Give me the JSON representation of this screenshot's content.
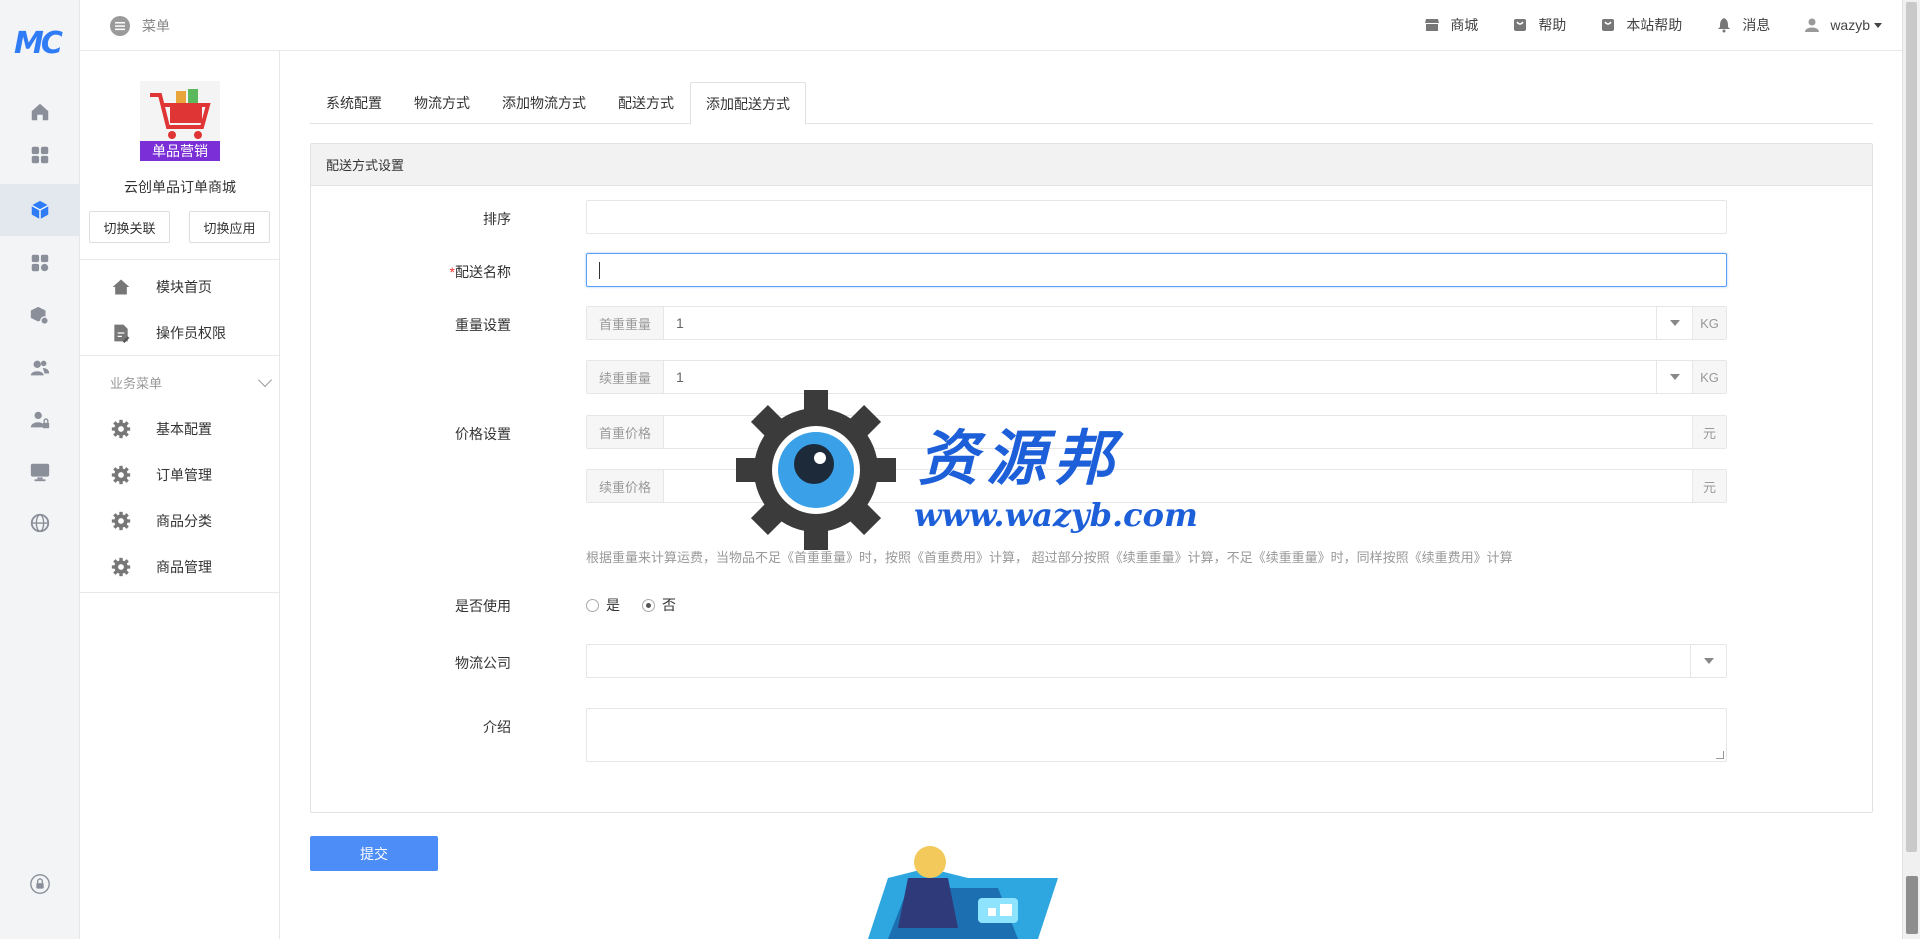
{
  "topbar": {
    "menu_label": "菜单",
    "items": [
      {
        "label": "商城",
        "icon": "store-icon"
      },
      {
        "label": "帮助",
        "icon": "help-bag-icon"
      },
      {
        "label": "本站帮助",
        "icon": "site-help-icon"
      },
      {
        "label": "消息",
        "icon": "bell-icon"
      }
    ],
    "user": "wazyb"
  },
  "rail": {
    "logo": "MC",
    "icons": [
      "home-icon",
      "grid-icon",
      "cube-icon",
      "apps-settings-icon",
      "package-settings-icon",
      "users-icon",
      "user-lock-icon",
      "monitor-icon",
      "globe-icon",
      "lock-icon"
    ]
  },
  "sidebar": {
    "app_logo_caption": "单品营销",
    "app_name": "云创单品订单商城",
    "switch_link": "切换关联",
    "switch_app": "切换应用",
    "top_items": [
      {
        "label": "模块首页",
        "icon": "home-icon"
      },
      {
        "label": "操作员权限",
        "icon": "doc-edit-icon"
      }
    ],
    "group_label": "业务菜单",
    "group_items": [
      {
        "label": "基本配置",
        "icon": "gear-icon"
      },
      {
        "label": "订单管理",
        "icon": "gear-icon"
      },
      {
        "label": "商品分类",
        "icon": "gear-icon"
      },
      {
        "label": "商品管理",
        "icon": "gear-icon"
      }
    ]
  },
  "tabs": [
    "系统配置",
    "物流方式",
    "添加物流方式",
    "配送方式",
    "添加配送方式"
  ],
  "active_tab": 4,
  "panel": {
    "title": "配送方式设置",
    "fields": {
      "sort_label": "排序",
      "sort_value": "",
      "name_required": "*",
      "name_label": "配送名称",
      "name_value": "",
      "weight_label": "重量设置",
      "first_weight_prefix": "首重重量",
      "first_weight_value": "1",
      "first_weight_unit": "KG",
      "cont_weight_prefix": "续重重量",
      "cont_weight_value": "1",
      "cont_weight_unit": "KG",
      "price_label": "价格设置",
      "first_price_prefix": "首重价格",
      "first_price_unit": "元",
      "cont_price_prefix": "续重价格",
      "cont_price_unit": "元",
      "hint": "根据重量来计算运费，当物品不足《首重重量》时，按照《首重费用》计算， 超过部分按照《续重重量》计算，不足《续重重量》时，同样按照《续重费用》计算",
      "enabled_label": "是否使用",
      "enabled_yes": "是",
      "enabled_no": "否",
      "enabled_selected": "否",
      "company_label": "物流公司",
      "company_value": "",
      "intro_label": "介绍",
      "intro_value": ""
    },
    "submit": "提交"
  },
  "watermark": {
    "title": "资源邦",
    "url": "www.wazyb.com"
  },
  "colors": {
    "primary": "#4d8df7",
    "rail_bg": "#f3f4f6",
    "watermark": "#1c5fd8",
    "required": "#e33333"
  }
}
